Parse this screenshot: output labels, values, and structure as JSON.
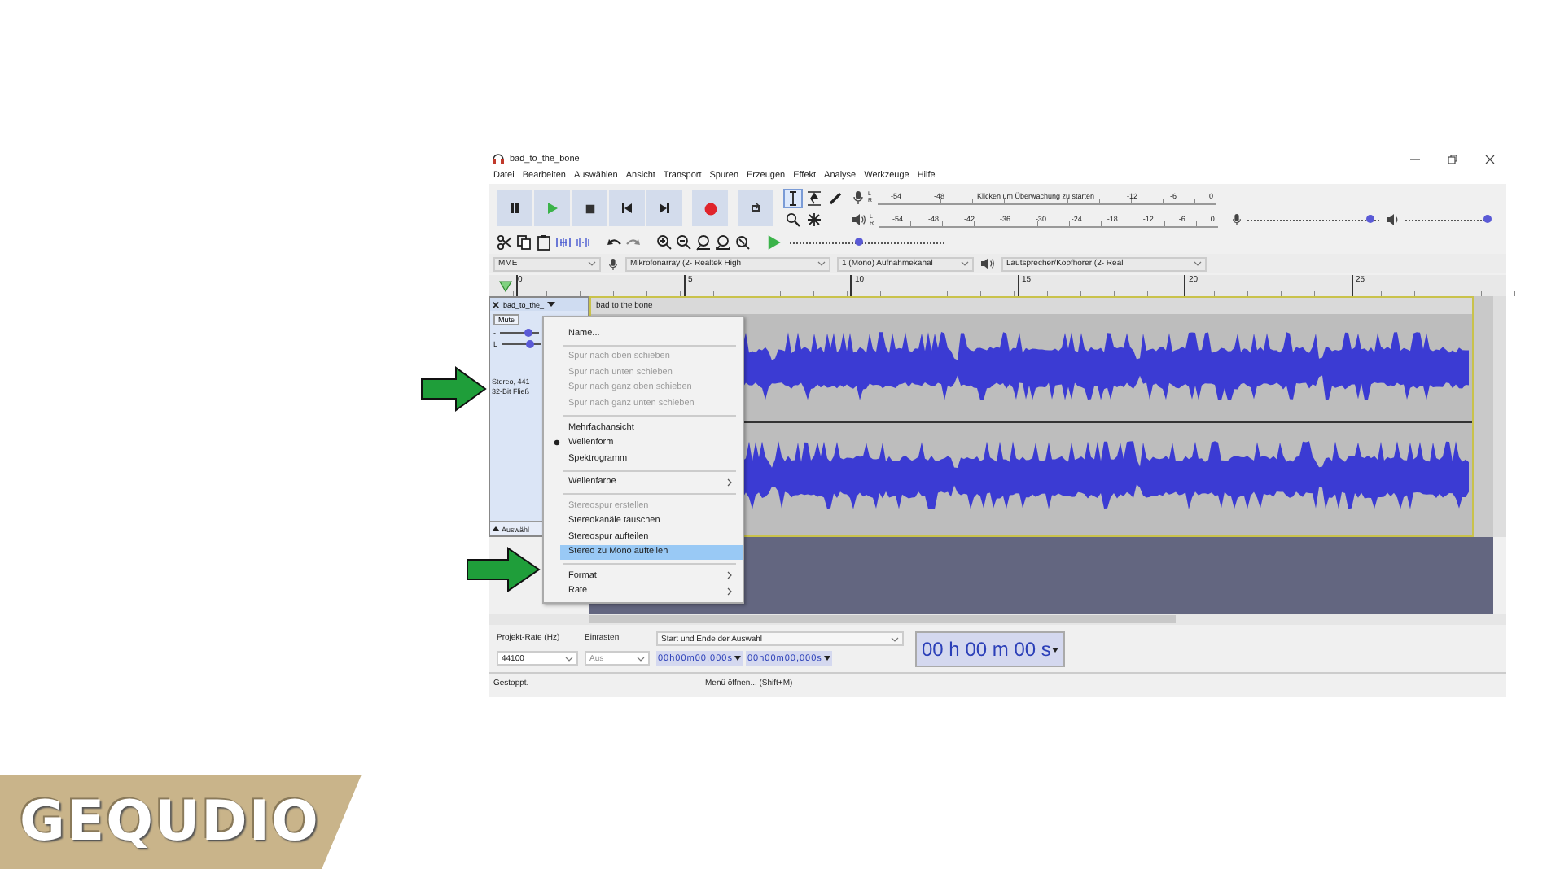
{
  "window": {
    "title": "bad_to_the_bone"
  },
  "menu": [
    "Datei",
    "Bearbeiten",
    "Auswählen",
    "Ansicht",
    "Transport",
    "Spuren",
    "Erzeugen",
    "Effekt",
    "Analyse",
    "Werkzeuge",
    "Hilfe"
  ],
  "tools": [
    {
      "kind": "select",
      "selected": true
    },
    {
      "kind": "envelope",
      "selected": false
    },
    {
      "kind": "draw",
      "selected": false
    },
    {
      "kind": "zoom",
      "selected": false
    },
    {
      "kind": "multi",
      "selected": false
    }
  ],
  "recording_meter": {
    "channels": [
      "L",
      "R"
    ],
    "scale": [
      "-54",
      "-48",
      "Klicken um Überwachung zu starten",
      "-12",
      "-6",
      "0"
    ]
  },
  "playback_meter": {
    "channels": [
      "L",
      "R"
    ],
    "scale": [
      "-54",
      "-48",
      "-42",
      "-36",
      "-30",
      "-24",
      "-18",
      "-12",
      "-6",
      "0"
    ]
  },
  "recording_volume": {
    "level": 0.92
  },
  "playback_volume": {
    "level": 1.0
  },
  "play_speed": {
    "level": 0.45
  },
  "device_bar": {
    "host": "MME",
    "recording_device": "Mikrofonarray (2- Realtek High",
    "channels": "1 (Mono) Aufnahmekanal",
    "playback_device": "Lautsprecher/Kopfhörer (2- Real"
  },
  "timeline": [
    "0",
    "5",
    "10",
    "15",
    "20",
    "25"
  ],
  "track": {
    "name": "bad_to_the_",
    "mute": "Mute",
    "gain_label": "-",
    "pan_label": "L",
    "gain": {
      "level": 0.75
    },
    "pan": {
      "level": 0.75
    },
    "info": [
      "Stereo, 441",
      "32-Bit Fließ"
    ],
    "select": "Auswähl",
    "clip_name": "bad to the bone"
  },
  "context_menu": {
    "groups": [
      {
        "items": [
          {
            "label": "Name...",
            "disabled": false,
            "checked": false,
            "selected": false,
            "submenu": false
          }
        ]
      },
      {
        "items": [
          {
            "label": "Spur nach oben schieben",
            "disabled": true,
            "checked": false,
            "selected": false,
            "submenu": false
          },
          {
            "label": "Spur nach unten schieben",
            "disabled": true,
            "checked": false,
            "selected": false,
            "submenu": false
          },
          {
            "label": "Spur nach ganz oben schieben",
            "disabled": true,
            "checked": false,
            "selected": false,
            "submenu": false
          },
          {
            "label": "Spur nach ganz unten schieben",
            "disabled": true,
            "checked": false,
            "selected": false,
            "submenu": false
          }
        ]
      },
      {
        "items": [
          {
            "label": "Mehrfachansicht",
            "disabled": false,
            "checked": false,
            "selected": false,
            "submenu": false
          },
          {
            "label": "Wellenform",
            "disabled": false,
            "checked": true,
            "selected": false,
            "submenu": false
          },
          {
            "label": "Spektrogramm",
            "disabled": false,
            "checked": false,
            "selected": false,
            "submenu": false
          }
        ]
      },
      {
        "items": [
          {
            "label": "Wellenfarbe",
            "disabled": false,
            "checked": false,
            "selected": false,
            "submenu": true
          }
        ]
      },
      {
        "items": [
          {
            "label": "Stereospur erstellen",
            "disabled": true,
            "checked": false,
            "selected": false,
            "submenu": false
          },
          {
            "label": "Stereokanäle tauschen",
            "disabled": false,
            "checked": false,
            "selected": false,
            "submenu": false
          },
          {
            "label": "Stereospur aufteilen",
            "disabled": false,
            "checked": false,
            "selected": false,
            "submenu": false
          },
          {
            "label": "Stereo zu Mono aufteilen",
            "disabled": false,
            "checked": false,
            "selected": true,
            "submenu": false
          }
        ]
      },
      {
        "items": [
          {
            "label": "Format",
            "disabled": false,
            "checked": false,
            "selected": false,
            "submenu": true
          },
          {
            "label": "Rate",
            "disabled": false,
            "checked": false,
            "selected": false,
            "submenu": true
          }
        ]
      }
    ]
  },
  "selection_bar": {
    "rate_label": "Projekt-Rate (Hz)",
    "rate": "44100",
    "snap_label": "Einrasten",
    "snap": "Aus",
    "mode": "Start und Ende der Auswahl",
    "start": "00h00m00,000s",
    "end": "00h00m00,000s",
    "time": "00 h 00 m 00 s"
  },
  "status_bar": {
    "state": "Gestoppt.",
    "hint": "Menü öffnen... (Shift+M)"
  },
  "logo": {
    "text": "GEQUDIO"
  }
}
